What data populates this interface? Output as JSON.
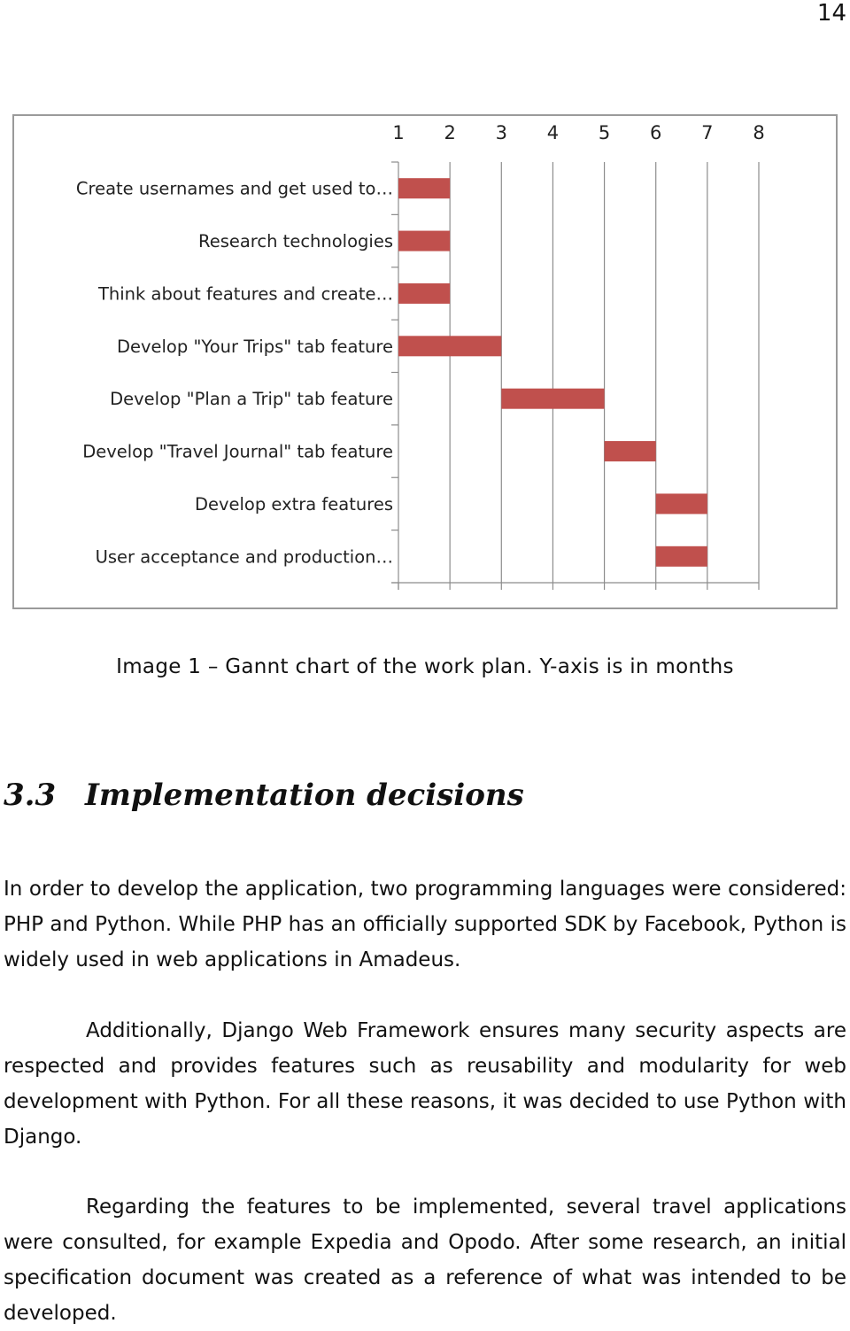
{
  "page": {
    "number": "14"
  },
  "chart_data": {
    "type": "bar",
    "subtype": "gantt",
    "title": "",
    "xlabel": "",
    "ylabel": "",
    "x_axis_position": "top",
    "x_ticks": [
      "1",
      "2",
      "3",
      "4",
      "5",
      "6",
      "7",
      "8"
    ],
    "xlim": [
      1,
      8
    ],
    "grid": "vertical",
    "legend": "none",
    "bar_color": "#C0504D",
    "categories": [
      "Create usernames and get used to…",
      "Research technologies",
      "Think about features and create…",
      "Develop \"Your Trips\" tab feature",
      "Develop \"Plan a Trip\" tab feature",
      "Develop \"Travel Journal\" tab feature",
      "Develop extra features",
      "User acceptance and production…"
    ],
    "series": [
      {
        "name": "start",
        "values": [
          1,
          1,
          1,
          1,
          3,
          5,
          6,
          6
        ]
      },
      {
        "name": "end",
        "values": [
          2,
          2,
          2,
          3,
          5,
          6,
          7,
          7
        ]
      }
    ]
  },
  "caption": "Image 1 – Gannt chart of the work plan. Y-axis is in months",
  "section": {
    "number": "3.3",
    "title": "Implementation decisions"
  },
  "paragraphs": [
    "In order to develop the application, two programming languages were considered: PHP and Python. While PHP has an officially supported SDK by Facebook, Python is widely used in web applications in Amadeus.",
    "Additionally, Django Web Framework ensures many security aspects are respected and provides features such as reusability and modularity for web development with Python. For all these reasons, it was decided to use Python with Django.",
    "Regarding the features to be implemented, several travel applications were consulted, for example Expedia and Opodo. After some research, an initial specification document was created as a reference of what was intended to be developed."
  ]
}
